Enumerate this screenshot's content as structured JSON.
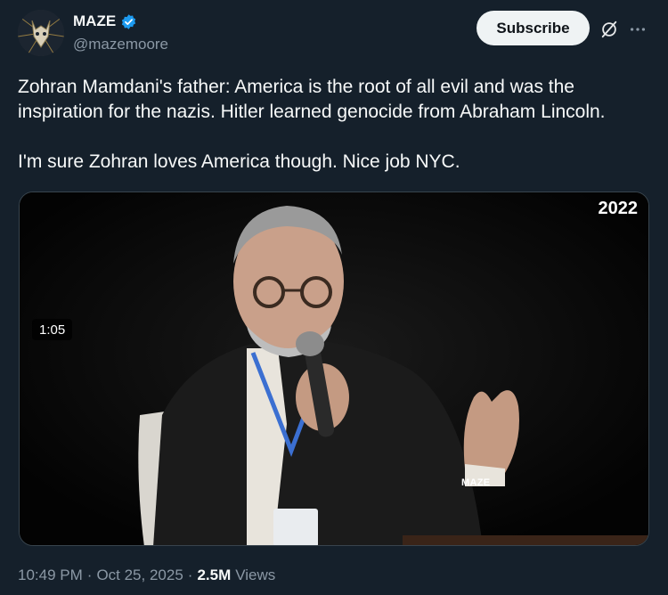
{
  "author": {
    "display_name": "MAZE",
    "handle": "@mazemoore",
    "verified": true
  },
  "actions": {
    "subscribe_label": "Subscribe",
    "grok_icon": "grok-icon",
    "more_icon": "more-icon"
  },
  "tweet": {
    "text": "Zohran Mamdani's father: America is the root of all evil and was the inspiration for the nazis. Hitler learned genocide from Abraham Lincoln.\n\nI'm sure Zohran loves America though. Nice job NYC."
  },
  "media": {
    "year_overlay": "2022",
    "watermark": "MAZE",
    "duration": "1:05"
  },
  "meta": {
    "time": "10:49 PM",
    "separator": "·",
    "date": "Oct 25, 2025",
    "views_count": "2.5M",
    "views_label": "Views"
  },
  "colors": {
    "background": "#15202b",
    "verified_blue": "#1d9bf0",
    "subscribe_bg": "#eff3f4",
    "secondary_text": "#8b98a5"
  }
}
